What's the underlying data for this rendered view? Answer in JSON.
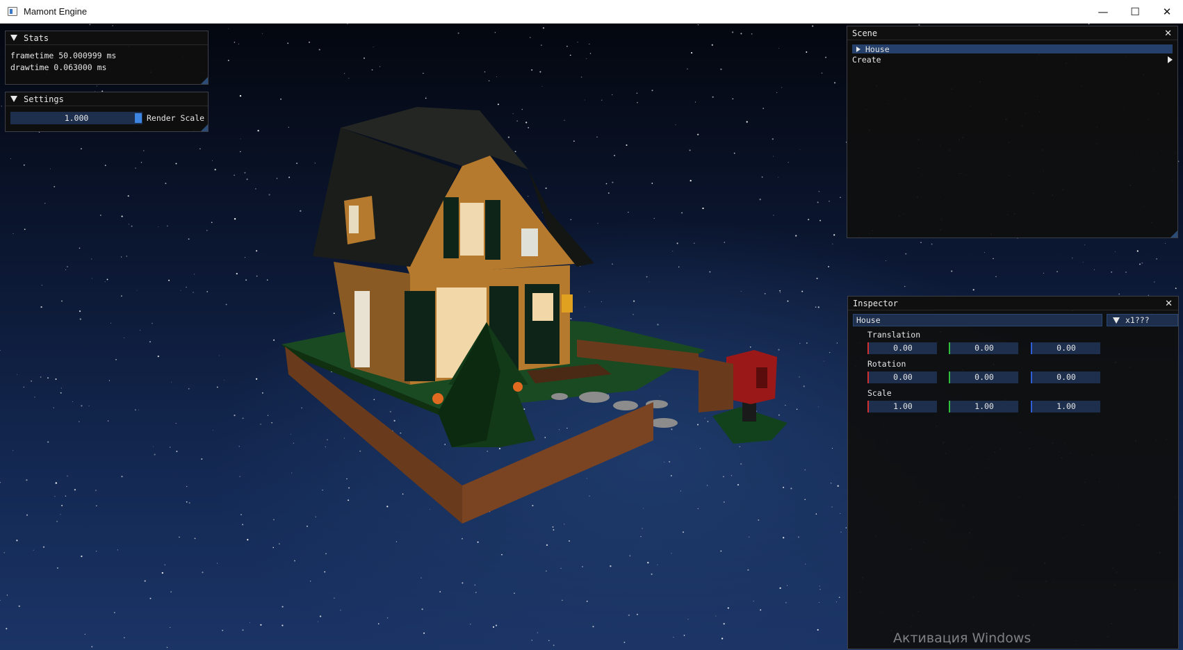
{
  "window": {
    "title": "Mamont Engine",
    "controls": {
      "minimize": "—",
      "maximize": "☐",
      "close": "✕"
    }
  },
  "stats": {
    "title": "Stats",
    "frametime": "frametime 50.000999 ms",
    "drawtime": "drawtime 0.063000 ms"
  },
  "settings": {
    "title": "Settings",
    "render_scale_value": "1.000",
    "render_scale_fraction": 1.0,
    "render_scale_label": "Render Scale"
  },
  "scene": {
    "title": "Scene",
    "close": "✕",
    "items": [
      {
        "label": "House"
      }
    ],
    "create_label": "Create"
  },
  "inspector": {
    "title": "Inspector",
    "close": "✕",
    "name_value": "House",
    "dropdown_value": "x1???",
    "translation_label": "Translation",
    "rotation_label": "Rotation",
    "scale_label": "Scale",
    "translation": {
      "x": "0.00",
      "y": "0.00",
      "z": "0.00"
    },
    "rotation": {
      "x": "0.00",
      "y": "0.00",
      "z": "0.00"
    },
    "scale": {
      "x": "1.00",
      "y": "1.00",
      "z": "1.00"
    }
  },
  "watermark": "Активация Windows",
  "colors": {
    "panel_bg": "#0f0f0f",
    "frame_bg": "#1d2f4d",
    "selected": "#25406a",
    "slider_grab": "#3d85e0",
    "axis_x": "#d43030",
    "axis_y": "#2fbf3a",
    "axis_z": "#2f5fd8"
  }
}
